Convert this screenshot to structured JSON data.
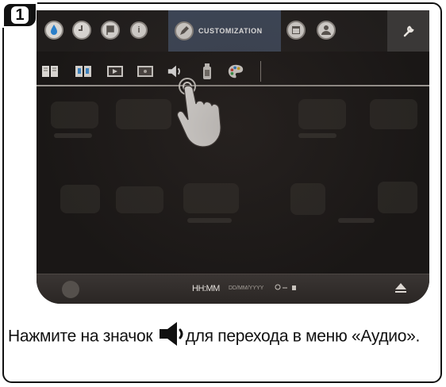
{
  "step": {
    "number": "1"
  },
  "device": {
    "top_tabs": [
      {
        "icon": "water-drop-icon"
      },
      {
        "icon": "clock-icon"
      },
      {
        "icon": "flag-icon"
      },
      {
        "icon": "info-icon",
        "text": "i"
      }
    ],
    "active_tab": {
      "icon": "pencil-icon",
      "label": "CUSTOMIZATION"
    },
    "extra_tabs": [
      {
        "icon": "calendar-icon"
      },
      {
        "icon": "group-icon"
      }
    ],
    "tools_tab": {
      "icon": "wrench-icon"
    },
    "sub_tabs": [
      {
        "icon": "book-icon"
      },
      {
        "icon": "open-book-icon"
      },
      {
        "icon": "picture-icon"
      },
      {
        "icon": "display-icon"
      },
      {
        "icon": "speaker-icon"
      },
      {
        "icon": "bottle-icon"
      },
      {
        "icon": "palette-icon"
      }
    ],
    "status": {
      "time": "HH:MM",
      "date": "DD/MM/YYYY"
    }
  },
  "caption": {
    "before": "Нажмите на значок ",
    "after": "для перехода в меню «Аудио»."
  },
  "colors": {
    "active_tab": "#3c4658",
    "screen_bg": "#1a1716",
    "text": "#111111"
  }
}
